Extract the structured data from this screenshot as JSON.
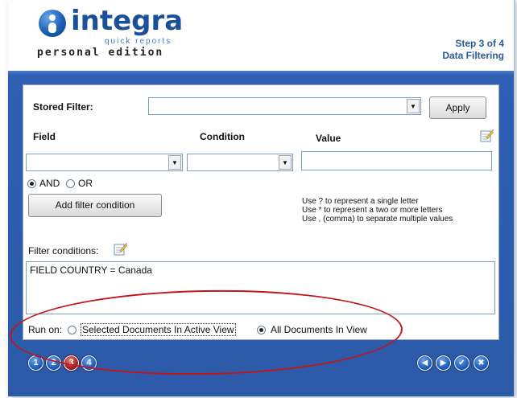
{
  "header": {
    "brand": "integra",
    "sub": "quick reports",
    "edition": "personal edition",
    "step": "Step 3 of 4",
    "step_title": "Data Filtering"
  },
  "stored_filter": {
    "label": "Stored Filter:",
    "value": "",
    "apply_label": "Apply"
  },
  "columns": {
    "field": "Field",
    "condition": "Condition",
    "value": "Value"
  },
  "logic": {
    "and_label": "AND",
    "or_label": "OR",
    "selected": "AND"
  },
  "add_condition_label": "Add filter condition",
  "hints": [
    "Use ? to represent a single letter",
    "Use * to represent a two or more letters",
    "Use , (comma) to separate multiple values"
  ],
  "filter_conditions": {
    "label": "Filter conditions:",
    "text": "FIELD COUNTRY = Canada"
  },
  "run_on": {
    "label": "Run on:",
    "option_selected_docs": "Selected Documents In Active View",
    "option_all_docs": "All Documents In View",
    "selected": "All Documents In View"
  },
  "steps": [
    "1",
    "2",
    "3",
    "4"
  ],
  "current_step": 3,
  "icons": {
    "back": "arrow-left-icon",
    "next": "arrow-right-icon",
    "finish": "checkmark-icon",
    "close": "close-icon",
    "notes": "notepad-icon"
  },
  "colors": {
    "accent": "#2c5aa8",
    "active_step": "#a32222",
    "highlight": "#c0161c"
  }
}
